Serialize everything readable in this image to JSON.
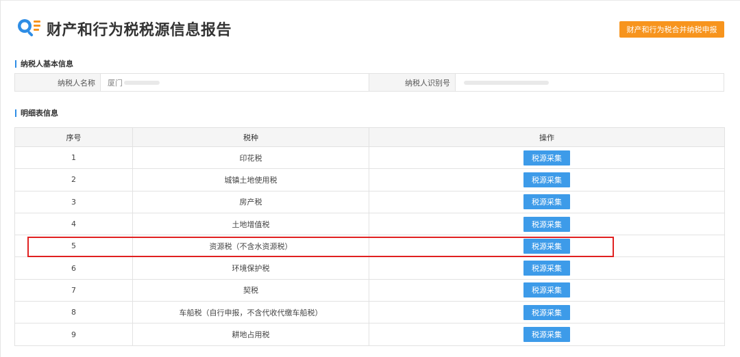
{
  "header": {
    "title": "财产和行为税税源信息报告",
    "merge_button": "财产和行为税合并纳税申报",
    "logo_icon": "search-list-icon"
  },
  "colors": {
    "accent_blue": "#3d9be9",
    "orange": "#f7941d",
    "highlight_red": "#e02020"
  },
  "basic_info": {
    "section_title": "纳税人基本信息",
    "name_label": "纳税人名称",
    "name_value": "厦门",
    "id_label": "纳税人识别号",
    "id_value": ""
  },
  "detail": {
    "section_title": "明细表信息",
    "columns": [
      "序号",
      "税种",
      "操作"
    ],
    "rows": [
      {
        "no": "1",
        "tax": "印花税",
        "action": "税源采集"
      },
      {
        "no": "2",
        "tax": "城镇土地使用税",
        "action": "税源采集"
      },
      {
        "no": "3",
        "tax": "房产税",
        "action": "税源采集"
      },
      {
        "no": "4",
        "tax": "土地增值税",
        "action": "税源采集"
      },
      {
        "no": "5",
        "tax": "资源税（不含水资源税）",
        "action": "税源采集"
      },
      {
        "no": "6",
        "tax": "环境保护税",
        "action": "税源采集"
      },
      {
        "no": "7",
        "tax": "契税",
        "action": "税源采集"
      },
      {
        "no": "8",
        "tax": "车船税（自行申报，不含代收代缴车船税）",
        "action": "税源采集"
      },
      {
        "no": "9",
        "tax": "耕地占用税",
        "action": "税源采集"
      }
    ]
  }
}
